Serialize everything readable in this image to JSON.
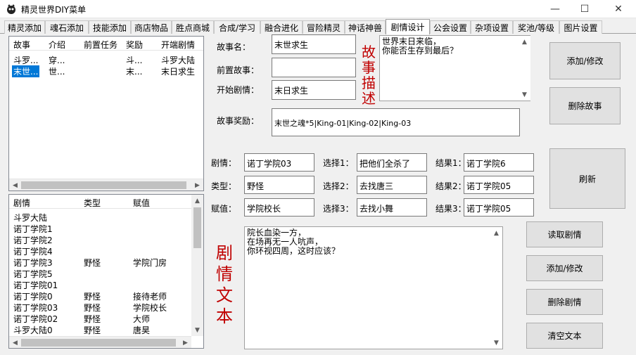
{
  "window": {
    "title": "精灵世界DIY菜单",
    "minimize": "—",
    "maximize": "☐",
    "close": "✕"
  },
  "tabs": [
    {
      "label": "精灵添加"
    },
    {
      "label": "魂石添加"
    },
    {
      "label": "技能添加"
    },
    {
      "label": "商店物品"
    },
    {
      "label": "胜点商城"
    },
    {
      "label": "合成/学习"
    },
    {
      "label": "融合进化"
    },
    {
      "label": "冒险精灵"
    },
    {
      "label": "神话神兽"
    },
    {
      "label": "剧情设计",
      "active": true
    },
    {
      "label": "公会设置"
    },
    {
      "label": "杂项设置"
    },
    {
      "label": "奖池/等级"
    },
    {
      "label": "图片设置"
    }
  ],
  "story_list": {
    "columns": [
      "故事",
      "介绍",
      "前置任务",
      "奖励",
      "开端剧情"
    ],
    "rows": [
      [
        "斗罗...",
        "穿...",
        "",
        "斗...",
        "斗罗大陆"
      ],
      [
        "末世...",
        "世...",
        "",
        "末...",
        "末日求生"
      ]
    ],
    "selected_row": 1
  },
  "plot_list": {
    "columns": [
      "剧情",
      "类型",
      "赋值"
    ],
    "rows": [
      [
        "斗罗大陆",
        "",
        ""
      ],
      [
        "诺丁学院1",
        "",
        ""
      ],
      [
        "诺丁学院2",
        "",
        ""
      ],
      [
        "诺丁学院4",
        "",
        ""
      ],
      [
        "诺丁学院3",
        "野怪",
        "学院门房"
      ],
      [
        "诺丁学院5",
        "",
        ""
      ],
      [
        "诺丁学院01",
        "",
        ""
      ],
      [
        "诺丁学院0",
        "野怪",
        "接待老师"
      ],
      [
        "诺丁学院03",
        "野怪",
        "学院校长"
      ],
      [
        "诺丁学院02",
        "野怪",
        "大师"
      ],
      [
        "斗罗大陆0",
        "野怪",
        "唐昊"
      ]
    ]
  },
  "story_form": {
    "name_label": "故事名：",
    "name_value": "末世求生",
    "prereq_label": "前置故事：",
    "prereq_value": "",
    "start_label": "开始剧情：",
    "start_value": "末日求生",
    "desc_caption": "故事描述",
    "desc_value": "世界末日来临，\n你能否生存到最后？",
    "reward_label": "故事奖励：",
    "reward_value": "末世之魂*5|King-01|King-02|King-03"
  },
  "plot_form": {
    "plot_label": "剧情：",
    "plot_value": "诺丁学院03",
    "type_label": "类型：",
    "type_value": "野怪",
    "assign_label": "赋值：",
    "assign_value": "学院校长",
    "choice1_label": "选择1：",
    "choice1_value": "把他们全杀了",
    "choice2_label": "选择2：",
    "choice2_value": "去找唐三",
    "choice3_label": "选择3：",
    "choice3_value": "去找小舞",
    "result1_label": "结果1：",
    "result1_value": "诺丁学院6",
    "result2_label": "结果2：",
    "result2_value": "诺丁学院05",
    "result3_label": "结果3：",
    "result3_value": "诺丁学院05",
    "text_caption": "剧情文本",
    "text_value": "院长血染一方，\n在场再无一人吭声，\n你环视四周，这时应该？"
  },
  "buttons": {
    "add_modify_story": "添加/修改",
    "delete_story": "删除故事",
    "refresh": "刷新",
    "read_plot": "读取剧情",
    "add_modify_plot": "添加/修改",
    "delete_plot": "删除剧情",
    "clear_text": "清空文本"
  },
  "colors": {
    "accent": "#0078d7",
    "caption_red": "#c00000"
  }
}
